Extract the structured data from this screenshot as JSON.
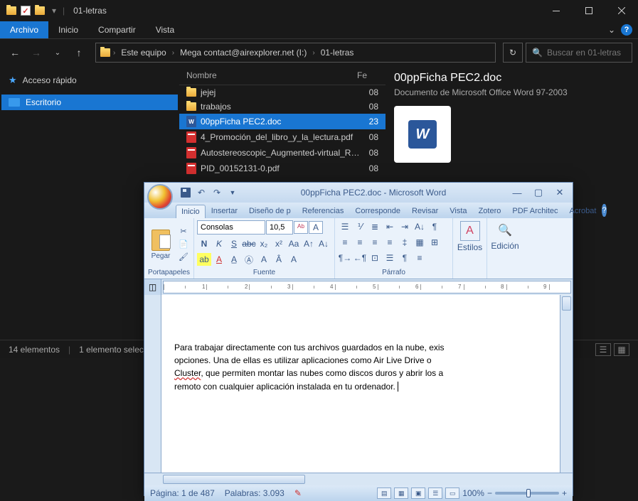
{
  "explorer": {
    "title": "01-letras",
    "ribbon_tabs": [
      "Archivo",
      "Inicio",
      "Compartir",
      "Vista"
    ],
    "breadcrumb": [
      "Este equipo",
      "Mega contact@airexplorer.net (I:)",
      "01-letras"
    ],
    "search_placeholder": "Buscar en 01-letras",
    "sidebar": {
      "quick": "Acceso rápido",
      "desktop": "Escritorio"
    },
    "columns": {
      "name": "Nombre",
      "date": "Fe"
    },
    "files": [
      {
        "icon": "folder",
        "name": "jejej",
        "date": "08"
      },
      {
        "icon": "folder",
        "name": "trabajos",
        "date": "08"
      },
      {
        "icon": "doc",
        "name": "00ppFicha PEC2.doc",
        "date": "23",
        "selected": true
      },
      {
        "icon": "pdf",
        "name": "4_Promoción_del_libro_y_la_lectura.pdf",
        "date": "08"
      },
      {
        "icon": "pdf",
        "name": "Autostereoscopic_Augmented-virtual_Re...",
        "date": "08"
      },
      {
        "icon": "pdf",
        "name": "PID_00152131-0.pdf",
        "date": "08"
      }
    ],
    "preview": {
      "title": "00ppFicha PEC2.doc",
      "subtitle": "Documento de Microsoft Office Word 97-2003"
    },
    "status": {
      "items": "14 elementos",
      "selected": "1 elemento selecci"
    }
  },
  "word": {
    "title": "00ppFicha PEC2.doc - Microsoft Word",
    "tabs": [
      "Inicio",
      "Insertar",
      "Diseño de p",
      "Referencias",
      "Corresponde",
      "Revisar",
      "Vista",
      "Zotero",
      "PDF Architec",
      "Acrobat"
    ],
    "groups": {
      "clipboard": "Portapapeles",
      "paste": "Pegar",
      "font": "Fuente",
      "paragraph": "Párrafo",
      "styles": "Estilos",
      "editing": "Edición"
    },
    "font": {
      "name": "Consolas",
      "size": "10,5"
    },
    "document_text": "Para trabajar directamente con tus archivos guardados en la nube, exis\nopciones. Una de ellas es utilizar aplicaciones como Air Live Drive o \nCluster, que permiten montar las nubes como discos duros y abrir los a\nremoto con cualquier aplicación instalada en tu ordenador.",
    "status": {
      "page": "Página: 1 de 487",
      "words": "Palabras: 3.093",
      "zoom": "100%"
    }
  }
}
